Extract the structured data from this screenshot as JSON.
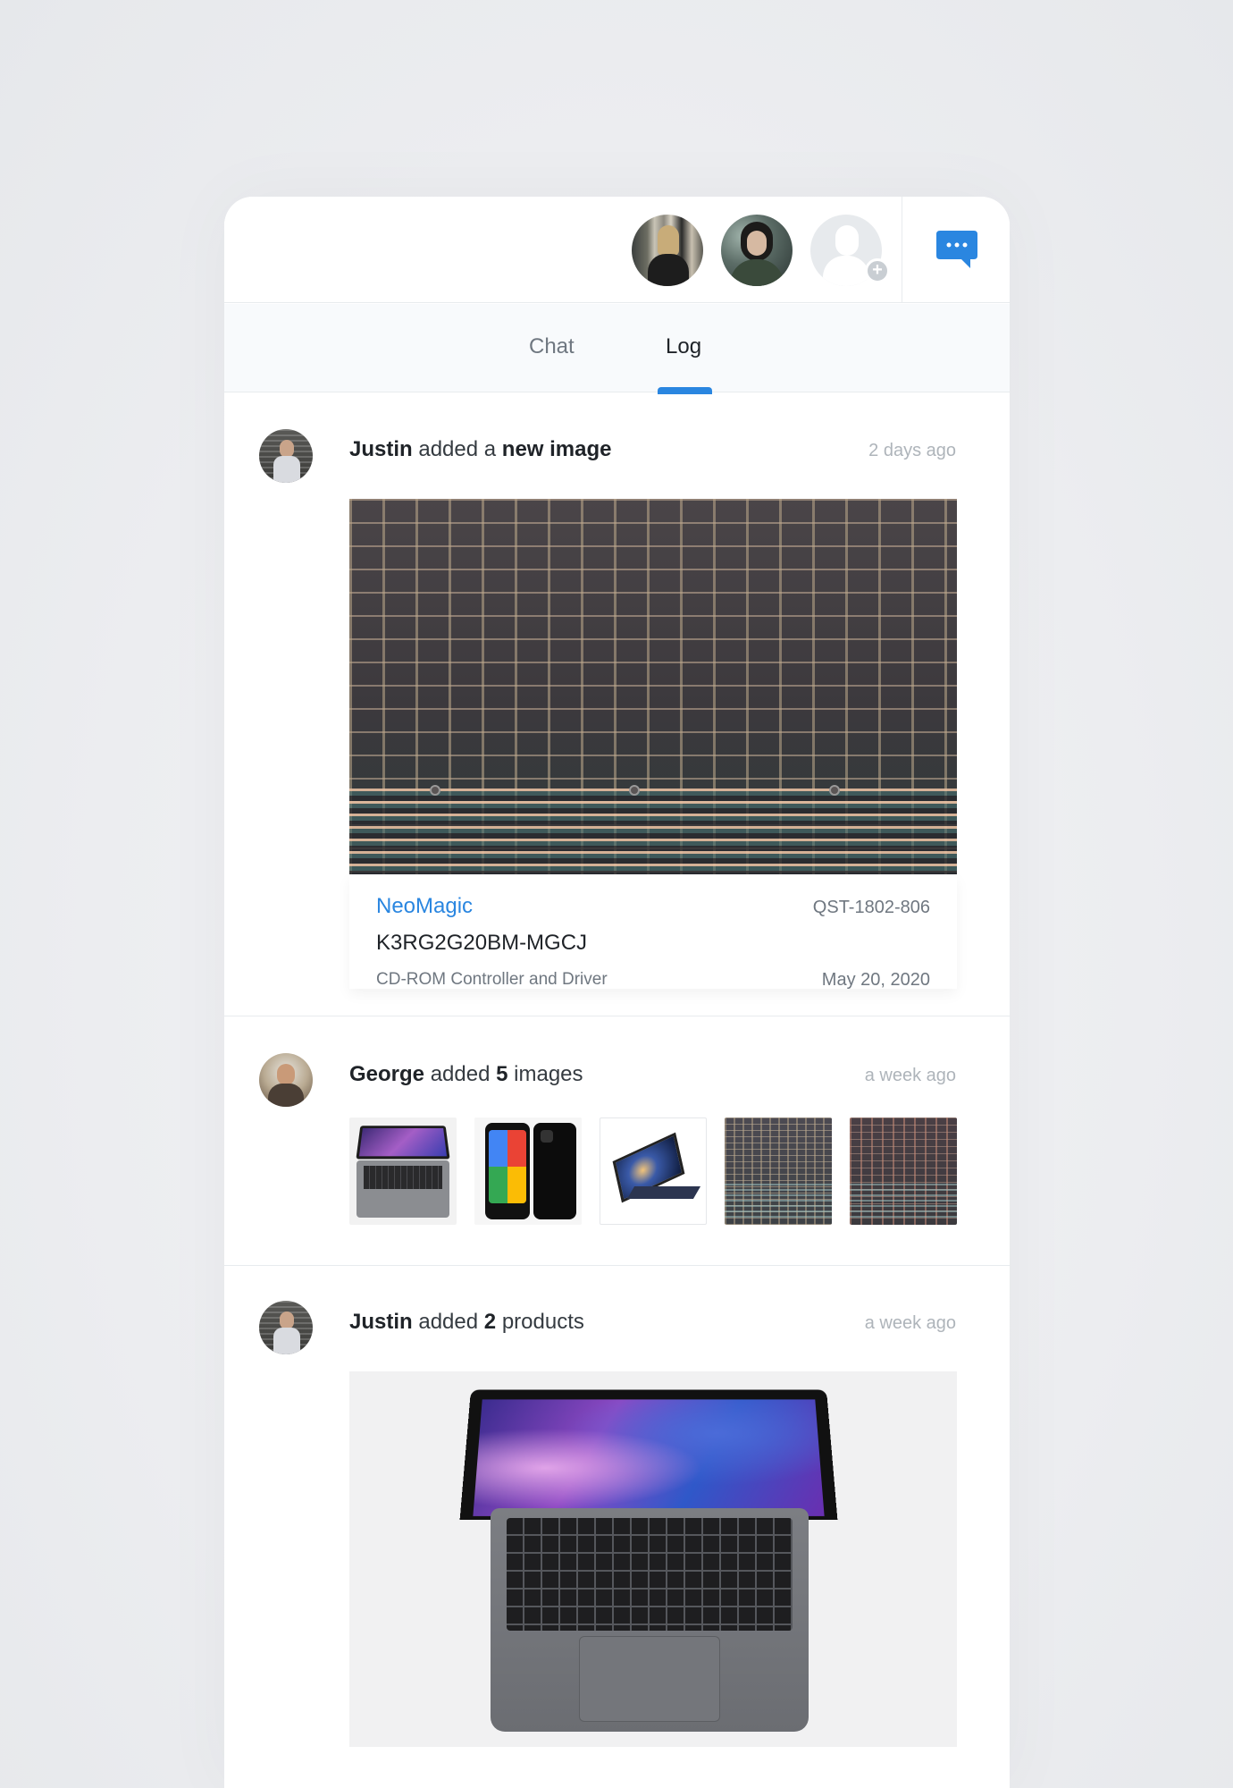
{
  "header": {
    "collaborators": [
      {
        "name": "collaborator-1"
      },
      {
        "name": "collaborator-2"
      }
    ],
    "add_collaborator_badge": "+",
    "chat_icon": "chat-bubble-icon",
    "accent_color": "#2a86e0"
  },
  "tabs": [
    {
      "label": "Chat",
      "active": false
    },
    {
      "label": "Log",
      "active": true
    }
  ],
  "feed": [
    {
      "user": "Justin",
      "verb": "added a",
      "object": "new image",
      "time": "2 days ago",
      "product": {
        "brand": "NeoMagic",
        "code": "QST-1802-806",
        "part_number": "K3RG2G20BM-MGCJ",
        "description": "CD-ROM Controller and Driver",
        "date": "May 20, 2020"
      }
    },
    {
      "user": "George",
      "verb": "added",
      "count": "5",
      "object": "images",
      "time": "a week ago",
      "thumbnails": [
        "laptop",
        "phones",
        "tablet",
        "chip-die-1",
        "chip-die-2"
      ]
    },
    {
      "user": "Justin",
      "verb": "added",
      "count": "2",
      "object": "products",
      "time": "a week ago"
    }
  ]
}
